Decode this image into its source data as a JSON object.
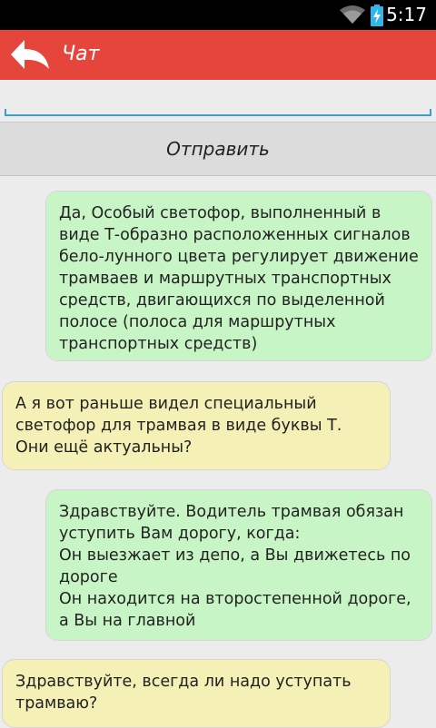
{
  "status_bar": {
    "time": "5:17"
  },
  "action_bar": {
    "title": "Чат"
  },
  "compose": {
    "input_value": "",
    "send_label": "Отправить"
  },
  "messages": [
    {
      "type": "outgoing",
      "text": "Да, Особый светофор, выполненный в виде Т-образно расположенных сигналов бело-лунного цвета регулирует движение трамваев и маршрутных транспортных средств, двигающихся по выделенной полосе (полоса для маршрутных транспортных средств)"
    },
    {
      "type": "incoming",
      "text": "А я вот раньше видел специальный светофор для трамвая в виде буквы Т. Они ещё актуальны?"
    },
    {
      "type": "outgoing",
      "text": "Здравствуйте. Водитель трамвая обязан уступить Вам дорогу, когда:\nОн выезжает из депо, а Вы движетесь по дороге\nОн находится на второстепенной дороге, а Вы на главной"
    },
    {
      "type": "incoming",
      "text": "Здравствуйте, всегда ли надо уступать трамваю?"
    }
  ]
}
